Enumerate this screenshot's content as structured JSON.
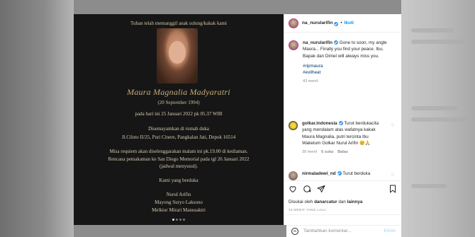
{
  "memorial": {
    "intro": "Tuhan telah memanggil anak sulung/kakak kami",
    "name": "Maura Magnalia Madyaratri",
    "birth": "(20 September 1994)",
    "death": "pada hari ini 25 Januari 2022 pk 05.37 WIB",
    "buried_1": "Disemayamkan di rumah duka",
    "buried_2": "Jl.Ciloto II/25, Puri Cinere, Pangkalan Jati, Depok 16514",
    "mass_1": "Misa requiem akan diselenggarakan malam ini pk.19.00 di kediaman.",
    "mass_2": "Rencana pemakaman ke San Diego Memorial pada tgl 26 Januari 2022",
    "mass_3": "(jadwal menyusul).",
    "grief": "Kami yang berduka",
    "sig_1": "Nurul Arifin",
    "sig_2": "Mayong Suryo Laksono",
    "sig_3": "Melkior Mirari Manusaktri"
  },
  "header": {
    "username": "na_nurularifin",
    "separator": "•",
    "follow_label": "Ikuti"
  },
  "caption": {
    "username": "na_nurularifin",
    "text": " Gone to soon, my angle Maura... Finally you find your peace. Ibu, Bapak dan Dimel will always miss you.",
    "hashtags": [
      "#ripmaura",
      "#evilheat"
    ],
    "time": "43 menit"
  },
  "comments": [
    {
      "username": "golkar.indonesia",
      "text": " Turut berdukacita yang mendalam atas wafatnya kakak Maura Magnalia, putri tercinta Ibu Waketum Golkar Nurul Arifin 😢🙏",
      "time": "39 menit",
      "likes": "6 suka",
      "reply": "Balas"
    },
    {
      "username": "nirmaladewi_nd",
      "text": " Turut berduka"
    }
  ],
  "likes": {
    "text_pre": "Disukai oleh ",
    "user": "danarcatur",
    "text_mid": " dan ",
    "others": "lainnya"
  },
  "time_ago": "43 MENIT YANG LALU",
  "add_comment": {
    "placeholder": "Tambahkan komentar...",
    "post_label": "Kirim"
  },
  "icons": [
    "heart-icon",
    "comment-icon",
    "share-icon",
    "save-icon",
    "emoji-icon",
    "verified-icon"
  ],
  "colors": {
    "accent": "#0095f6",
    "memorial_bg": "#161616",
    "memorial_gold": "#c5ac7c"
  }
}
